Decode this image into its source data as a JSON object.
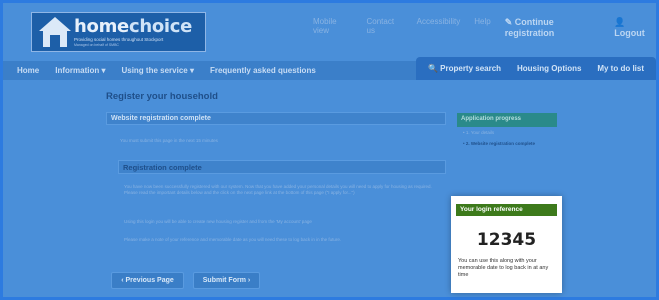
{
  "header": {
    "logo": {
      "home": "home",
      "choice": "choice",
      "tagline": "Providing social homes throughout Stockport",
      "subtagline": "Managed on behalf of SMBC"
    },
    "links": [
      "Mobile view",
      "Contact us",
      "Accessibility",
      "Help"
    ],
    "continue_label": "Continue registration",
    "logout_label": "Logout"
  },
  "nav": {
    "left": [
      "Home",
      "Information ▾",
      "Using the service ▾",
      "Frequently asked questions"
    ],
    "right": [
      "Property search",
      "Housing Options",
      "My to do list"
    ]
  },
  "main": {
    "title": "Register your household",
    "panel_title": "Website registration complete",
    "notice": "You must submit this page in the next 15 minutes",
    "section_title": "Registration complete",
    "paragraphs": [
      "You have now been successfully registered with our system. Now that you have added your personal details you will need to apply for housing as required. Please read the important details below and the click on the next page link at the bottom of this page (\"I apply for...\")",
      "Using this login you will be able to create new housing register and from the 'My account' page",
      "Please make a note of your reference and memorable date as you will need these to log back in in the future."
    ],
    "prev_button": "Previous Page",
    "submit_button": "Submit Form"
  },
  "sidebar": {
    "title": "Application progress",
    "steps": [
      "1. Your details",
      "2. Website registration complete"
    ]
  },
  "popup": {
    "title": "Your login reference",
    "reference": "12345",
    "text": "You can use this along with your memorable date to log back in at any time"
  },
  "colors": {
    "brand_blue": "#2d7be0",
    "popup_header_green": "#3d7a1b"
  }
}
